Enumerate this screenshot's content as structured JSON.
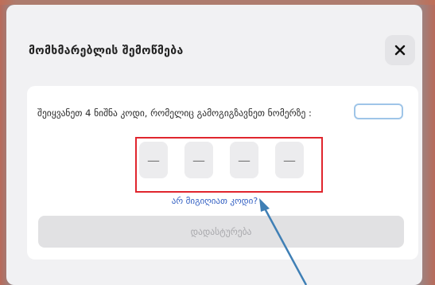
{
  "modal": {
    "title": "მომხმარებლის შემოწმება",
    "close_icon": "close-icon",
    "close_glyph": "✕"
  },
  "verification": {
    "instruction": "შეიყვანეთ 4 ნიშნა კოდი, რომელიც გამოგიგზავნეთ ნომერზე :",
    "phone_value": "",
    "otp_placeholders": [
      "—",
      "—",
      "—",
      "—"
    ],
    "forgot_link": "არ მიგიღიათ კოდი?",
    "confirm_label": "დადასტურება"
  },
  "annotation": {
    "highlight_color": "#e0262e",
    "arrow_color": "#3f7fb5"
  }
}
